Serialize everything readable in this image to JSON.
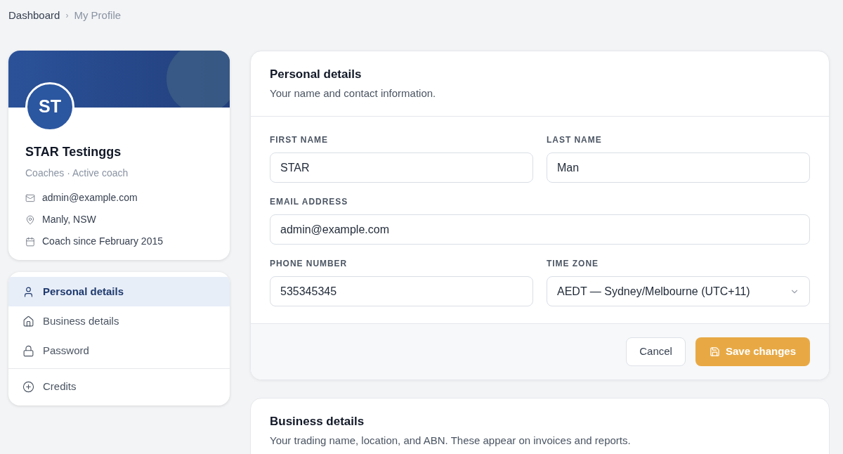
{
  "breadcrumb": [
    {
      "label": "Dashboard",
      "current": false
    },
    {
      "label": "My Profile",
      "current": true
    }
  ],
  "breadcrumb_separator": "›",
  "profile": {
    "initials": "ST",
    "name": "STAR Testinggs",
    "subtitle": "Coaches · Active coach",
    "details": [
      "admin@example.com",
      "Manly, NSW",
      "Coach since February 2015"
    ]
  },
  "nav": {
    "items": [
      {
        "label": "Personal details",
        "selected": true
      },
      {
        "label": "Business details",
        "selected": false
      },
      {
        "label": "Password",
        "selected": false
      }
    ],
    "footer_items": [
      {
        "label": "Credits",
        "selected": false
      }
    ]
  },
  "personal_details": {
    "title": "Personal details",
    "subtitle": "Your name and contact information.",
    "rows": [
      [
        {
          "kind": "text",
          "label": "FIRST NAME",
          "value": "STAR"
        },
        {
          "kind": "text",
          "label": "LAST NAME",
          "value": "Man"
        }
      ],
      [
        {
          "kind": "text",
          "label": "EMAIL ADDRESS",
          "value": "admin@example.com"
        }
      ],
      [
        {
          "kind": "text",
          "label": "PHONE NUMBER",
          "value": "535345345"
        },
        {
          "kind": "select",
          "label": "TIME ZONE",
          "value": "AEDT — Sydney/Melbourne (UTC+11)"
        }
      ]
    ],
    "buttons": [
      {
        "kind": "secondary",
        "label": "Cancel"
      },
      {
        "kind": "primary",
        "label": "Save changes"
      }
    ]
  },
  "business_details": {
    "title": "Business details",
    "subtitle": "Your trading name, location, and ABN. These appear on invoices and reports."
  }
}
